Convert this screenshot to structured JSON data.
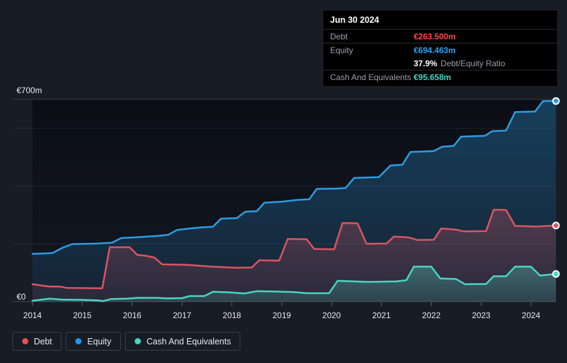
{
  "tooltip": {
    "date": "Jun 30 2024",
    "debt_label": "Debt",
    "debt_value": "€263.500m",
    "equity_label": "Equity",
    "equity_value": "€694.463m",
    "ratio_value": "37.9%",
    "ratio_label": "Debt/Equity Ratio",
    "cash_label": "Cash And Equivalents",
    "cash_value": "€95.658m"
  },
  "legend": {
    "items": [
      {
        "label": "Debt",
        "color": "#e8504e"
      },
      {
        "label": "Equity",
        "color": "#2196f3"
      },
      {
        "label": "Cash And Equivalents",
        "color": "#41d9c1"
      }
    ]
  },
  "colors": {
    "page_background": "#171c25",
    "plot_background_top": "#0b0e15",
    "plot_background_bottom": "#121722",
    "debt_line": "#dc5560",
    "equity_line": "#2f9de4",
    "cash_line": "#4bd6c2",
    "gridline": "rgba(255,255,255,0.09)",
    "axis_line": "rgba(255,255,255,0.22)"
  },
  "chart_data": {
    "type": "area",
    "unit": "€m",
    "currency": "EUR",
    "legend_position": "bottom-left",
    "grid": "horizontal-only",
    "x_axis": {
      "min": 2014,
      "max": 2024.5,
      "ticks": [
        2014,
        2015,
        2016,
        2017,
        2018,
        2019,
        2020,
        2021,
        2022,
        2023,
        2024
      ]
    },
    "y_axis": {
      "min": 0,
      "max": 700,
      "gridlines": [
        700,
        600,
        400,
        200,
        0
      ],
      "labels": [
        {
          "value": 700,
          "text": "€700m"
        },
        {
          "value": 0,
          "text": "€0"
        }
      ]
    },
    "series": [
      {
        "name": "Equity",
        "color": "#2f9de4",
        "end_value": 694.463,
        "points": [
          [
            2014.0,
            165
          ],
          [
            2014.4,
            168
          ],
          [
            2014.6,
            186
          ],
          [
            2014.8,
            199
          ],
          [
            2015.3,
            201
          ],
          [
            2015.6,
            204
          ],
          [
            2015.78,
            220
          ],
          [
            2016.1,
            223
          ],
          [
            2016.55,
            228
          ],
          [
            2016.72,
            231
          ],
          [
            2016.9,
            248
          ],
          [
            2017.15,
            253
          ],
          [
            2017.4,
            257
          ],
          [
            2017.62,
            259
          ],
          [
            2017.78,
            287
          ],
          [
            2018.1,
            289
          ],
          [
            2018.27,
            311
          ],
          [
            2018.5,
            313
          ],
          [
            2018.65,
            342
          ],
          [
            2019.0,
            346
          ],
          [
            2019.3,
            352
          ],
          [
            2019.55,
            354
          ],
          [
            2019.7,
            390
          ],
          [
            2020.1,
            391
          ],
          [
            2020.28,
            393
          ],
          [
            2020.45,
            428
          ],
          [
            2020.95,
            431
          ],
          [
            2021.18,
            471
          ],
          [
            2021.42,
            474
          ],
          [
            2021.58,
            518
          ],
          [
            2022.05,
            521
          ],
          [
            2022.22,
            536
          ],
          [
            2022.45,
            539
          ],
          [
            2022.6,
            571
          ],
          [
            2023.08,
            574
          ],
          [
            2023.22,
            590
          ],
          [
            2023.5,
            592
          ],
          [
            2023.68,
            656
          ],
          [
            2024.08,
            658
          ],
          [
            2024.24,
            694
          ],
          [
            2024.5,
            694.463
          ]
        ]
      },
      {
        "name": "Debt",
        "color": "#dc5560",
        "end_value": 263.5,
        "points": [
          [
            2014.0,
            60
          ],
          [
            2014.35,
            52
          ],
          [
            2014.55,
            52
          ],
          [
            2014.7,
            47
          ],
          [
            2015.4,
            46
          ],
          [
            2015.55,
            188
          ],
          [
            2015.95,
            188
          ],
          [
            2016.1,
            162
          ],
          [
            2016.3,
            158
          ],
          [
            2016.45,
            152
          ],
          [
            2016.6,
            129
          ],
          [
            2017.1,
            127
          ],
          [
            2017.6,
            121
          ],
          [
            2018.1,
            117
          ],
          [
            2018.4,
            118
          ],
          [
            2018.55,
            143
          ],
          [
            2018.95,
            142
          ],
          [
            2019.12,
            217
          ],
          [
            2019.5,
            216
          ],
          [
            2019.65,
            182
          ],
          [
            2020.05,
            181
          ],
          [
            2020.22,
            272
          ],
          [
            2020.52,
            271
          ],
          [
            2020.7,
            200
          ],
          [
            2021.1,
            201
          ],
          [
            2021.25,
            225
          ],
          [
            2021.55,
            222
          ],
          [
            2021.72,
            213
          ],
          [
            2022.05,
            214
          ],
          [
            2022.2,
            253
          ],
          [
            2022.5,
            249
          ],
          [
            2022.65,
            243
          ],
          [
            2023.1,
            244
          ],
          [
            2023.25,
            318
          ],
          [
            2023.5,
            317
          ],
          [
            2023.68,
            262
          ],
          [
            2024.1,
            260
          ],
          [
            2024.5,
            263.5
          ]
        ]
      },
      {
        "name": "Cash And Equivalents",
        "color": "#4bd6c2",
        "end_value": 95.658,
        "points": [
          [
            2014.0,
            3
          ],
          [
            2014.35,
            10
          ],
          [
            2014.6,
            7
          ],
          [
            2015.0,
            6
          ],
          [
            2015.3,
            4
          ],
          [
            2015.42,
            2
          ],
          [
            2015.58,
            9
          ],
          [
            2015.9,
            10
          ],
          [
            2016.1,
            13
          ],
          [
            2016.5,
            13
          ],
          [
            2016.7,
            11
          ],
          [
            2017.0,
            12
          ],
          [
            2017.15,
            19
          ],
          [
            2017.45,
            19
          ],
          [
            2017.62,
            34
          ],
          [
            2017.95,
            32
          ],
          [
            2018.25,
            28
          ],
          [
            2018.5,
            36
          ],
          [
            2018.85,
            35
          ],
          [
            2019.25,
            33
          ],
          [
            2019.5,
            29
          ],
          [
            2019.95,
            29
          ],
          [
            2020.12,
            72
          ],
          [
            2020.45,
            70
          ],
          [
            2020.75,
            68
          ],
          [
            2021.3,
            70
          ],
          [
            2021.5,
            74
          ],
          [
            2021.65,
            121
          ],
          [
            2022.0,
            121
          ],
          [
            2022.18,
            80
          ],
          [
            2022.5,
            78
          ],
          [
            2022.68,
            60
          ],
          [
            2023.1,
            61
          ],
          [
            2023.25,
            88
          ],
          [
            2023.5,
            88
          ],
          [
            2023.68,
            121
          ],
          [
            2024.0,
            121
          ],
          [
            2024.18,
            90
          ],
          [
            2024.5,
            95.658
          ]
        ]
      }
    ]
  }
}
